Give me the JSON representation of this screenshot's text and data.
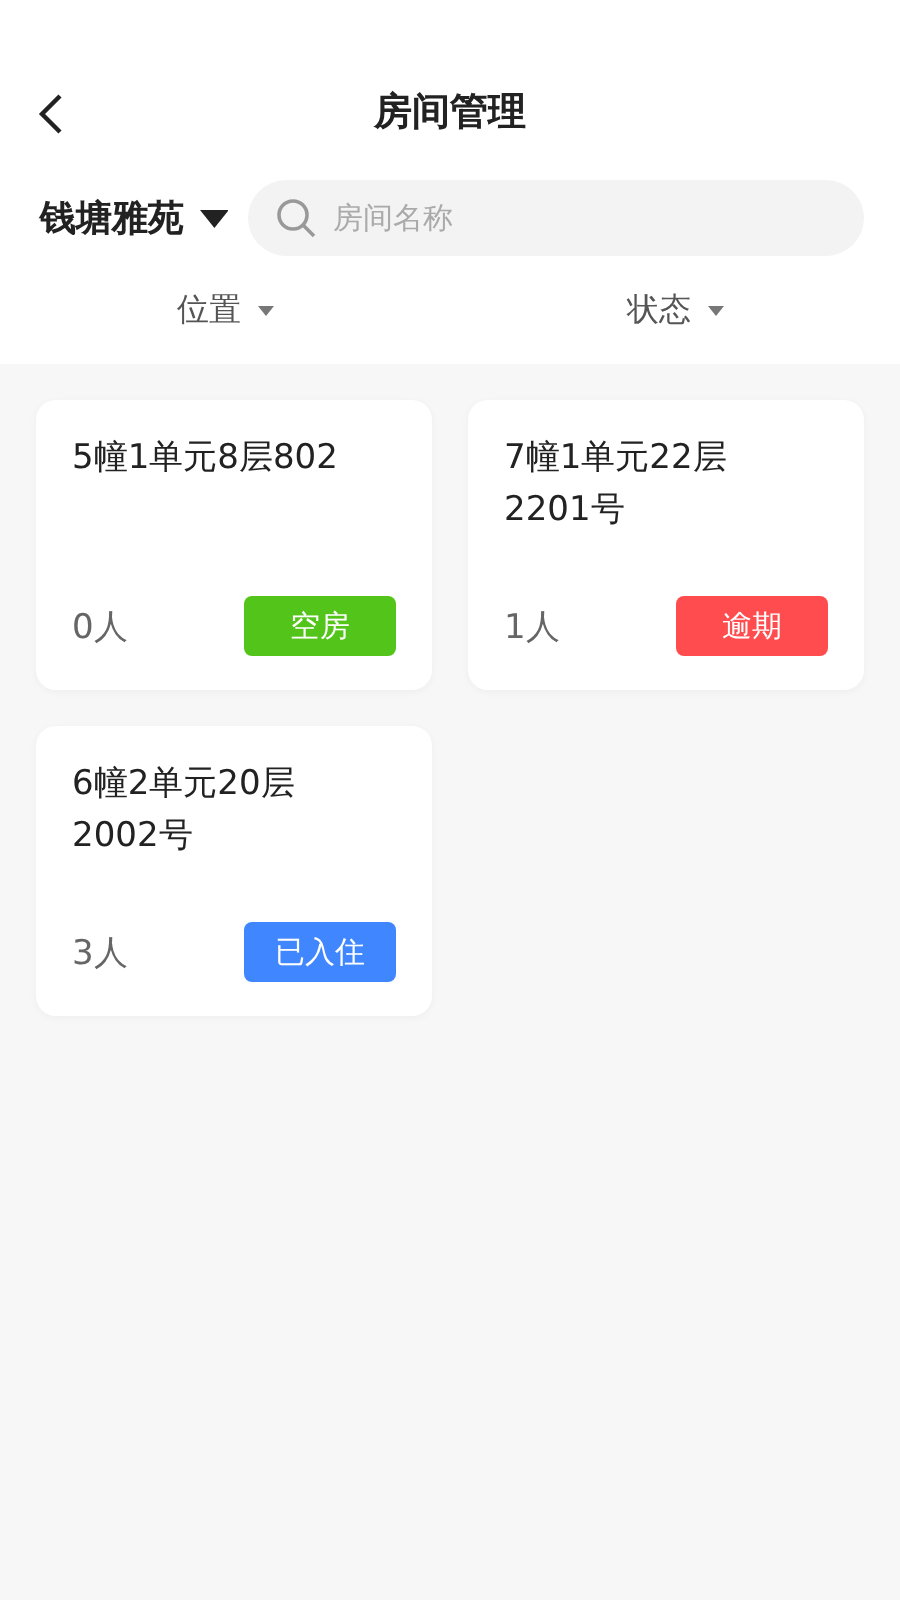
{
  "header": {
    "title": "房间管理"
  },
  "community": {
    "name": "钱塘雅苑"
  },
  "search": {
    "placeholder": "房间名称"
  },
  "filters": [
    {
      "label": "位置"
    },
    {
      "label": "状态"
    }
  ],
  "rooms": [
    {
      "name": "5幢1单元8层802",
      "occupants": "0人",
      "status": "空房",
      "color": "#52c41a"
    },
    {
      "name": "7幢1单元22层2201号",
      "occupants": "1人",
      "status": "逾期",
      "color": "#ff4d4f"
    },
    {
      "name": "6幢2单元20层2002号",
      "occupants": "3人",
      "status": "已入住",
      "color": "#3f86ff"
    }
  ]
}
